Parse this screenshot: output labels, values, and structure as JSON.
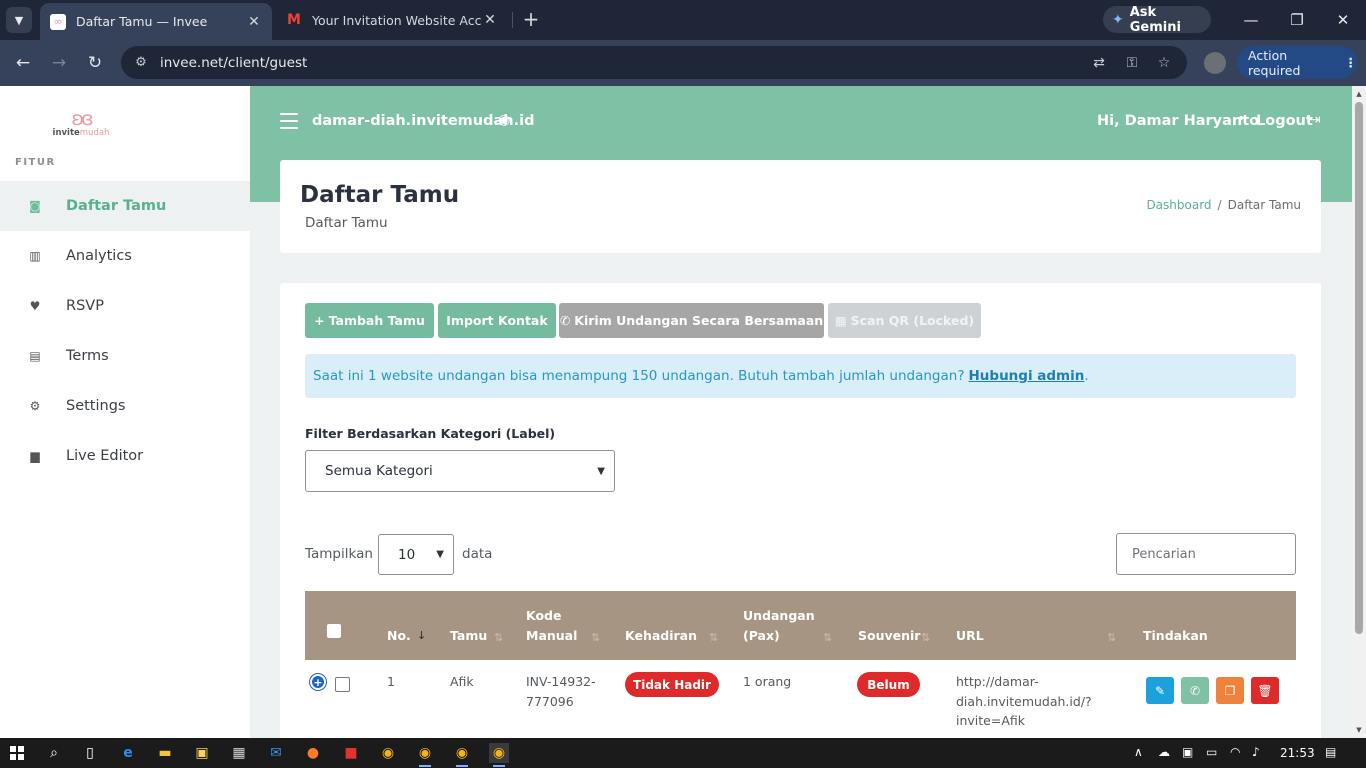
{
  "browser": {
    "tabs": [
      {
        "title": "Daftar Tamu — Invee",
        "favicon": "invee-icon",
        "active": true
      },
      {
        "title": "Your Invitation Website Account",
        "favicon": "gmail-icon",
        "active": false
      }
    ],
    "gemini_label": "Ask Gemini",
    "url": "invee.net/client/guest",
    "action_required_label": "Action required"
  },
  "sidebar": {
    "logo_prefix": "invite",
    "logo_suffix": "mudah",
    "section_label": "FITUR",
    "items": [
      {
        "label": "Daftar Tamu",
        "icon": "user-icon",
        "active": true
      },
      {
        "label": "Analytics",
        "icon": "chart-icon",
        "active": false
      },
      {
        "label": "RSVP",
        "icon": "heart-icon",
        "active": false
      },
      {
        "label": "Terms",
        "icon": "file-icon",
        "active": false
      },
      {
        "label": "Settings",
        "icon": "gear-icon",
        "active": false
      },
      {
        "label": "Live Editor",
        "icon": "paint-roller-icon",
        "active": false
      }
    ]
  },
  "header": {
    "site_name": "damar-diah.invitemudah.id",
    "greeting": "Hi, Damar Haryanto",
    "logout_label": "Logout"
  },
  "page": {
    "title": "Daftar Tamu",
    "subtitle": "Daftar Tamu",
    "breadcrumb": {
      "home": "Dashboard",
      "current": "Daftar Tamu"
    }
  },
  "actions": {
    "add_guest": "Tambah Tamu",
    "import_contacts": "Import Kontak",
    "send_all": "Kirim Undangan Secara Bersamaan",
    "scan_qr": "Scan QR (Locked)"
  },
  "info": {
    "text": "Saat ini 1 website undangan bisa menampung 150 undangan. Butuh tambah jumlah undangan?",
    "link": "Hubungi admin",
    "suffix": "."
  },
  "filter": {
    "label": "Filter Berdasarkan Kategori (Label)",
    "selected": "Semua Kategori"
  },
  "table_controls": {
    "show_label": "Tampilkan",
    "page_size": "10",
    "data_label": "data",
    "search_placeholder": "Pencarian"
  },
  "table": {
    "headers": {
      "no": "No.",
      "guest": "Tamu",
      "code_line1": "Kode",
      "code_line2": "Manual",
      "attendance": "Kehadiran",
      "invites_line1": "Undangan",
      "invites_line2": "(Pax)",
      "souvenir": "Souvenir",
      "url": "URL",
      "actions": "Tindakan"
    },
    "rows": [
      {
        "no": "1",
        "guest": "Afik",
        "code_line1": "INV-14932-",
        "code_line2": "777096",
        "attendance": "Tidak Hadir",
        "invites": "1 orang",
        "souvenir": "Belum",
        "url_line1": "http://damar-",
        "url_line2": "diah.invitemudah.id/?",
        "url_line3": "invite=Afik"
      }
    ]
  },
  "taskbar": {
    "time": "21:53"
  },
  "colors": {
    "brand_green": "#7ec1a5",
    "table_header": "#a69583",
    "danger": "#de2a2a",
    "info_bg": "#d9eef9"
  }
}
